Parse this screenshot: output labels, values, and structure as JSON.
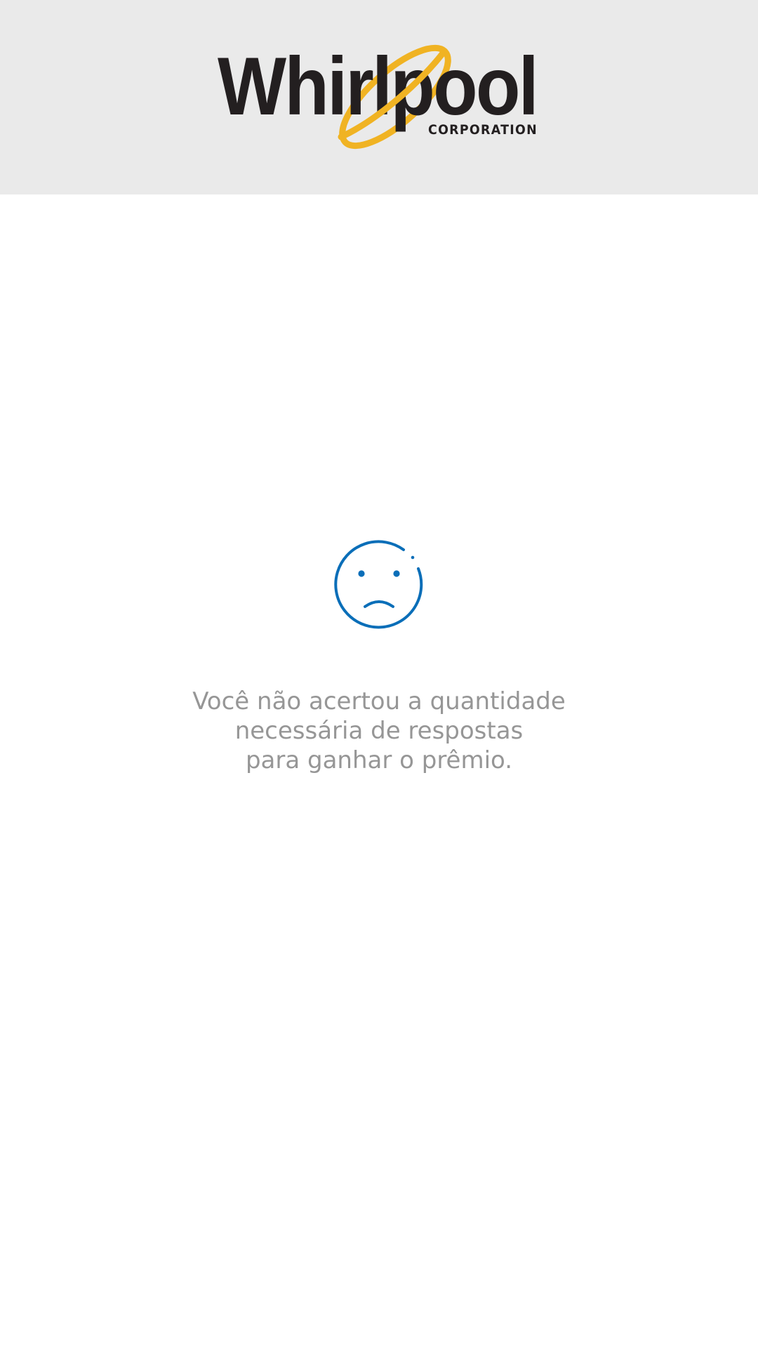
{
  "header": {
    "logo": {
      "word": "Whirlpool",
      "tagline": "CORPORATION",
      "ring_color": "#f0b323",
      "text_color": "#231f20"
    },
    "background_color": "#eaeaea"
  },
  "result": {
    "icon": "sad-face-icon",
    "icon_color": "#0a6eb8",
    "message_lines": [
      "Você não acertou a quantidade",
      "necessária de respostas",
      "para ganhar o prêmio."
    ],
    "message_color": "#969696"
  }
}
